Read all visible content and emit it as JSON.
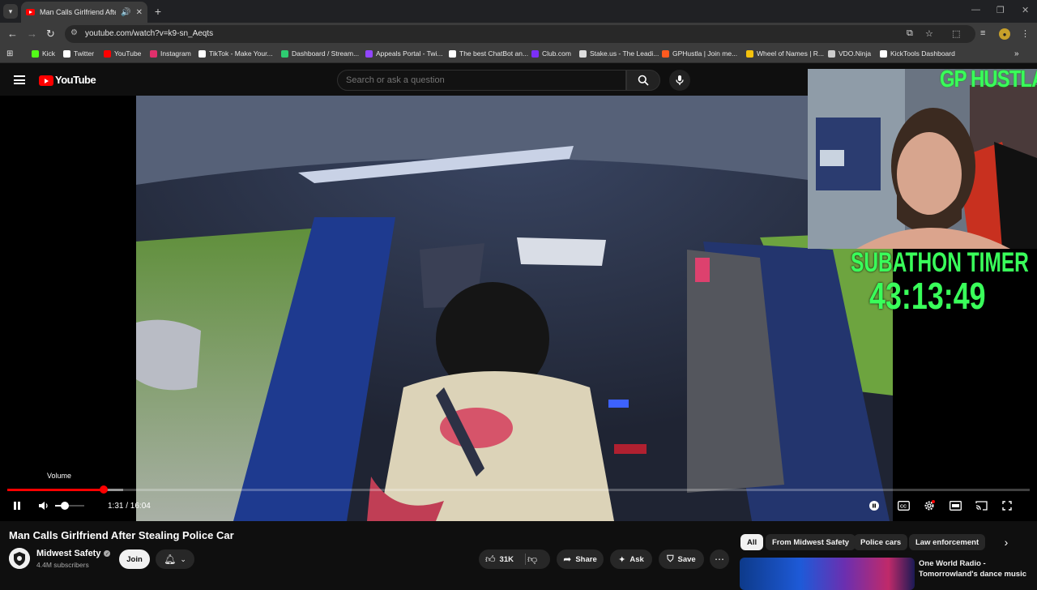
{
  "browser": {
    "tab_title": "Man Calls Girlfriend After Stealing Police Car",
    "url": "youtube.com/watch?v=k9-sn_Aeqts",
    "bookmarks": [
      {
        "label": "Kick",
        "color": "#53fc18"
      },
      {
        "label": "Twitter",
        "color": "#ffffff"
      },
      {
        "label": "YouTube",
        "color": "#ff0000"
      },
      {
        "label": "Instagram",
        "color": "#e1306c"
      },
      {
        "label": "TikTok - Make Your...",
        "color": "#ffffff"
      },
      {
        "label": "Dashboard / Stream...",
        "color": "#2ecc71"
      },
      {
        "label": "Appeals Portal - Twi...",
        "color": "#9146ff"
      },
      {
        "label": "The best ChatBot an...",
        "color": "#ffffff"
      },
      {
        "label": "Club.com",
        "color": "#7b2ff7"
      },
      {
        "label": "Stake.us - The Leadi...",
        "color": "#dddddd"
      },
      {
        "label": "GPHustla | Join me...",
        "color": "#ff5a1f"
      },
      {
        "label": "Wheel of Names | R...",
        "color": "#f4c20d"
      },
      {
        "label": "VDO.Ninja",
        "color": "#cccccc"
      },
      {
        "label": "KickTools Dashboard",
        "color": "#ffffff"
      }
    ]
  },
  "youtube": {
    "logo_text": "YouTube",
    "search_placeholder": "Search or ask a question"
  },
  "overlay": {
    "streamer_name": "GP HUSTLA",
    "subathon_label": "SUBATHON TIMER",
    "subathon_time": "43:13:49"
  },
  "player": {
    "volume_tooltip": "Volume",
    "time_current": "1:31",
    "time_total": "16:04",
    "time_display": "1:31 / 16:04",
    "progress_played_fraction": 0.0944,
    "progress_buffered_fraction": 0.113,
    "volume_fraction": 0.33
  },
  "video": {
    "title": "Man Calls Girlfriend After Stealing Police Car",
    "channel_name": "Midwest Safety",
    "subscribers": "4.4M subscribers",
    "join_label": "Join",
    "like_count": "31K",
    "share_label": "Share",
    "ask_label": "Ask",
    "save_label": "Save"
  },
  "chips": [
    "All",
    "From Midwest Safety",
    "Police cars",
    "Law enforcement"
  ],
  "recommendation": {
    "title": "One World Radio - Tomorrowland's dance music"
  }
}
